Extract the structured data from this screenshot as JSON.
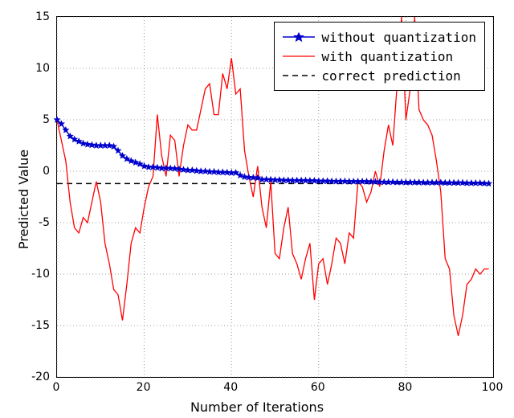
{
  "chart_data": {
    "type": "line",
    "title": "",
    "xlabel": "Number of Iterations",
    "ylabel": "Predicted Value",
    "xlim": [
      0,
      100
    ],
    "ylim": [
      -20,
      15
    ],
    "xticks": [
      0,
      20,
      40,
      60,
      80,
      100
    ],
    "yticks": [
      -20,
      -15,
      -10,
      -5,
      0,
      5,
      10,
      15
    ],
    "grid": true,
    "legend_position": "upper right",
    "correct_prediction": -1.2,
    "series": [
      {
        "name": "without quantization",
        "color": "#0000cd",
        "marker": "star",
        "x": [
          0,
          1,
          2,
          3,
          4,
          5,
          6,
          7,
          8,
          9,
          10,
          11,
          12,
          13,
          14,
          15,
          16,
          17,
          18,
          19,
          20,
          21,
          22,
          23,
          24,
          25,
          26,
          27,
          28,
          29,
          30,
          31,
          32,
          33,
          34,
          35,
          36,
          37,
          38,
          39,
          40,
          41,
          42,
          43,
          44,
          45,
          46,
          47,
          48,
          49,
          50,
          51,
          52,
          53,
          54,
          55,
          56,
          57,
          58,
          59,
          60,
          61,
          62,
          63,
          64,
          65,
          66,
          67,
          68,
          69,
          70,
          71,
          72,
          73,
          74,
          75,
          76,
          77,
          78,
          79,
          80,
          81,
          82,
          83,
          84,
          85,
          86,
          87,
          88,
          89,
          90,
          91,
          92,
          93,
          94,
          95,
          96,
          97,
          98,
          99
        ],
        "values": [
          5.0,
          4.6,
          4.0,
          3.4,
          3.1,
          2.9,
          2.7,
          2.6,
          2.55,
          2.5,
          2.5,
          2.5,
          2.5,
          2.4,
          2.0,
          1.5,
          1.2,
          1.0,
          0.85,
          0.7,
          0.5,
          0.4,
          0.4,
          0.35,
          0.3,
          0.3,
          0.28,
          0.25,
          0.2,
          0.15,
          0.1,
          0.1,
          0.05,
          0.0,
          0.0,
          -0.05,
          -0.05,
          -0.1,
          -0.1,
          -0.12,
          -0.15,
          -0.15,
          -0.4,
          -0.55,
          -0.6,
          -0.62,
          -0.65,
          -0.8,
          -0.8,
          -0.82,
          -0.85,
          -0.85,
          -0.88,
          -0.88,
          -0.9,
          -0.9,
          -0.9,
          -0.9,
          -0.92,
          -0.92,
          -0.95,
          -0.95,
          -0.95,
          -0.98,
          -0.98,
          -0.98,
          -0.98,
          -1.0,
          -1.0,
          -1.0,
          -1.0,
          -1.0,
          -1.02,
          -1.02,
          -1.05,
          -1.05,
          -1.05,
          -1.05,
          -1.07,
          -1.07,
          -1.08,
          -1.08,
          -1.08,
          -1.08,
          -1.1,
          -1.1,
          -1.1,
          -1.1,
          -1.1,
          -1.12,
          -1.12,
          -1.12,
          -1.12,
          -1.12,
          -1.15,
          -1.15,
          -1.15,
          -1.15,
          -1.18,
          -1.2
        ]
      },
      {
        "name": "with quantization",
        "color": "#ff0000",
        "marker": null,
        "x": [
          0,
          1,
          2,
          3,
          4,
          5,
          6,
          7,
          8,
          9,
          10,
          11,
          12,
          13,
          14,
          15,
          16,
          17,
          18,
          19,
          20,
          21,
          22,
          23,
          24,
          25,
          26,
          27,
          28,
          29,
          30,
          31,
          32,
          33,
          34,
          35,
          36,
          37,
          38,
          39,
          40,
          41,
          42,
          43,
          44,
          45,
          46,
          47,
          48,
          49,
          50,
          51,
          52,
          53,
          54,
          55,
          56,
          57,
          58,
          59,
          60,
          61,
          62,
          63,
          64,
          65,
          66,
          67,
          68,
          69,
          70,
          71,
          72,
          73,
          74,
          75,
          76,
          77,
          78,
          79,
          80,
          81,
          82,
          83,
          84,
          85,
          86,
          87,
          88,
          89,
          90,
          91,
          92,
          93,
          94,
          95,
          96,
          97,
          98,
          99
        ],
        "values": [
          5.0,
          3.0,
          1.0,
          -3.0,
          -5.5,
          -6.0,
          -4.5,
          -5.0,
          -3.0,
          -1.0,
          -3.0,
          -7.0,
          -9.0,
          -11.5,
          -12.0,
          -14.5,
          -11.0,
          -7.0,
          -5.5,
          -6.0,
          -3.5,
          -1.5,
          -0.5,
          5.5,
          1.5,
          -0.5,
          3.5,
          3.0,
          -0.5,
          2.5,
          4.5,
          4.0,
          4.0,
          6.0,
          8.0,
          8.5,
          5.5,
          5.5,
          9.5,
          8.0,
          11.0,
          7.5,
          8.0,
          2.0,
          -0.5,
          -2.5,
          0.5,
          -3.5,
          -5.5,
          -1.0,
          -8.0,
          -8.5,
          -5.5,
          -3.5,
          -8.0,
          -9.0,
          -10.5,
          -8.5,
          -7.0,
          -12.5,
          -9.0,
          -8.5,
          -11.0,
          -9.0,
          -6.5,
          -7.0,
          -9.0,
          -6.0,
          -6.5,
          -1.0,
          -1.5,
          -3.0,
          -2.0,
          0.0,
          -1.5,
          2.0,
          4.5,
          2.5,
          8.5,
          15.0,
          5.0,
          8.0,
          15.0,
          6.0,
          5.0,
          4.5,
          3.5,
          1.0,
          -2.0,
          -8.5,
          -9.5,
          -14.0,
          -16.0,
          -14.0,
          -11.0,
          -10.5,
          -9.5,
          -10.0,
          -9.5,
          -9.5
        ]
      },
      {
        "name": "correct prediction",
        "color": "#000000",
        "style": "dashed",
        "x": [
          0,
          99
        ],
        "values": [
          -1.2,
          -1.2
        ]
      }
    ]
  },
  "legend": {
    "items": [
      {
        "label": "without quantization"
      },
      {
        "label": "with quantization"
      },
      {
        "label": "correct prediction"
      }
    ]
  },
  "axes": {
    "xlabel": "Number of Iterations",
    "ylabel": "Predicted Value",
    "xticks_labels": [
      "0",
      "20",
      "40",
      "60",
      "80",
      "100"
    ],
    "yticks_labels": [
      "-20",
      "-15",
      "-10",
      "-5",
      "0",
      "5",
      "10",
      "15"
    ]
  }
}
